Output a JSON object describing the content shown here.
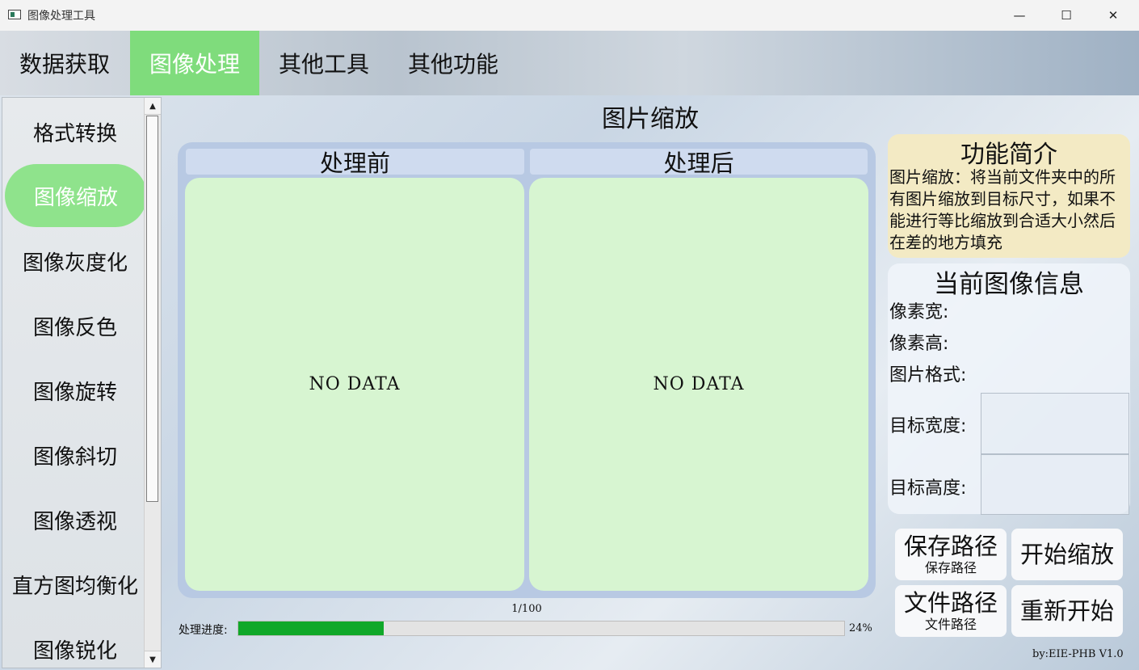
{
  "window": {
    "title": "图像处理工具",
    "controls": {
      "minimize": "—",
      "maximize": "☐",
      "close": "✕"
    }
  },
  "top_nav": {
    "items": [
      {
        "label": "数据获取",
        "active": false
      },
      {
        "label": "图像处理",
        "active": true
      },
      {
        "label": "其他工具",
        "active": false
      },
      {
        "label": "其他功能",
        "active": false
      }
    ]
  },
  "sidebar": {
    "items": [
      {
        "label": "格式转换",
        "active": false
      },
      {
        "label": "图像缩放",
        "active": true
      },
      {
        "label": "图像灰度化",
        "active": false
      },
      {
        "label": "图像反色",
        "active": false
      },
      {
        "label": "图像旋转",
        "active": false
      },
      {
        "label": "图像斜切",
        "active": false
      },
      {
        "label": "图像透视",
        "active": false
      },
      {
        "label": "直方图均衡化",
        "active": false
      },
      {
        "label": "图像锐化",
        "active": false
      }
    ],
    "scroll_up": "▲",
    "scroll_down": "▼"
  },
  "main": {
    "title": "图片缩放",
    "before_label": "处理前",
    "after_label": "处理后",
    "before_placeholder": "NO DATA",
    "after_placeholder": "NO DATA"
  },
  "progress": {
    "counter": "1/100",
    "label": "处理进度:",
    "percent_text": "24%",
    "fraction": 0.24,
    "fill_color": "#10a829"
  },
  "intro": {
    "title": "功能简介",
    "text": "图片缩放：将当前文件夹中的所有图片缩放到目标尺寸，如果不能进行等比缩放到合适大小然后在差的地方填充"
  },
  "image_info": {
    "title": "当前图像信息",
    "pixel_width_label": "像素宽:",
    "pixel_height_label": "像素高:",
    "format_label": "图片格式:",
    "target_width_label": "目标宽度:",
    "target_height_label": "目标高度:",
    "target_width_value": "",
    "target_height_value": ""
  },
  "buttons": {
    "save_path": {
      "label": "保存路径",
      "sub": "保存路径"
    },
    "start_scale": {
      "label": "开始缩放"
    },
    "file_path": {
      "label": "文件路径",
      "sub": "文件路径"
    },
    "restart": {
      "label": "重新开始"
    }
  },
  "footer": {
    "text": "by:EIE-PHB V1.0"
  },
  "colors": {
    "active_green": "#7fdc7c",
    "pane_green": "#d7f5d1",
    "intro_bg": "#f3eac4",
    "progress_green": "#10a829"
  }
}
